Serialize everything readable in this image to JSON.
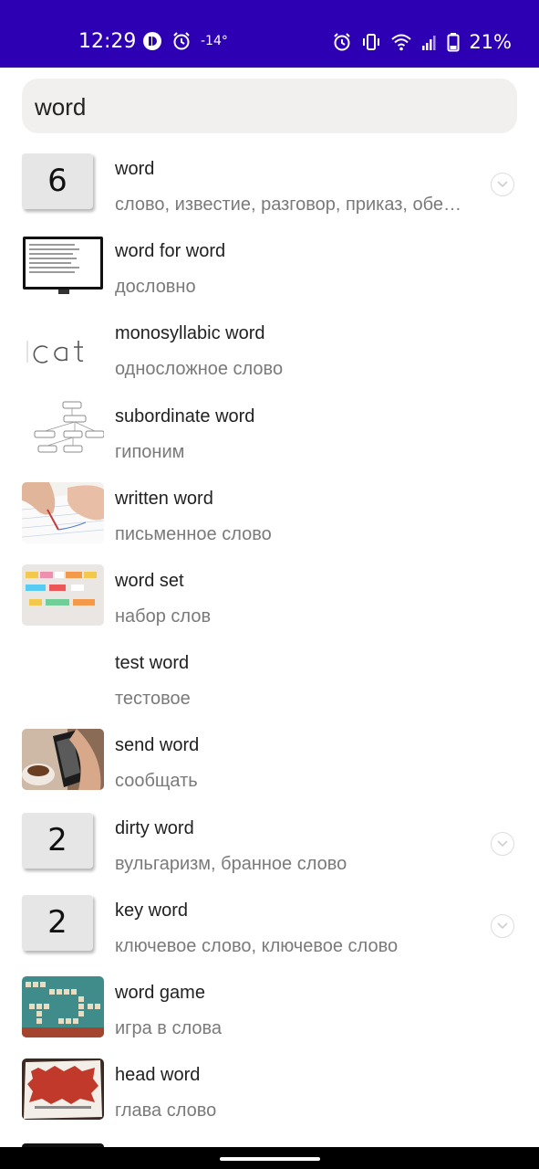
{
  "status": {
    "time": "12:29",
    "temperature": "-14°",
    "battery": "21%",
    "bar_color": "#2d00b3"
  },
  "search": {
    "value": "word",
    "placeholder": ""
  },
  "results": [
    {
      "title": "word",
      "subtitle": "слово, известие, разговор, приказ, обе…",
      "thumb": "count",
      "count": "6",
      "expandable": true
    },
    {
      "title": "word for word",
      "subtitle": "дословно",
      "thumb": "monitor-image",
      "expandable": false
    },
    {
      "title": "monosyllabic word",
      "subtitle": "односложное слово",
      "thumb": "cat-text-image",
      "expandable": false
    },
    {
      "title": "subordinate word",
      "subtitle": "гипоним",
      "thumb": "diagram-image",
      "expandable": false
    },
    {
      "title": "written word",
      "subtitle": "письменное слово",
      "thumb": "writing-hand-image",
      "expandable": false
    },
    {
      "title": "word set",
      "subtitle": "набор слов",
      "thumb": "word-labels-image",
      "expandable": false
    },
    {
      "title": "test word",
      "subtitle": "тестовое",
      "thumb": "none",
      "expandable": false
    },
    {
      "title": "send word",
      "subtitle": "сообщать",
      "thumb": "phone-image",
      "expandable": false
    },
    {
      "title": "dirty word",
      "subtitle": "вульгаризм, бранное слово",
      "thumb": "count",
      "count": "2",
      "expandable": true
    },
    {
      "title": "key word",
      "subtitle": "ключевое слово, ключевое слово",
      "thumb": "count",
      "count": "2",
      "expandable": true
    },
    {
      "title": "word game",
      "subtitle": "игра в слова",
      "thumb": "scrabble-image",
      "expandable": false
    },
    {
      "title": "head word",
      "subtitle": "глава слово",
      "thumb": "bazinga-image",
      "expandable": false
    }
  ]
}
